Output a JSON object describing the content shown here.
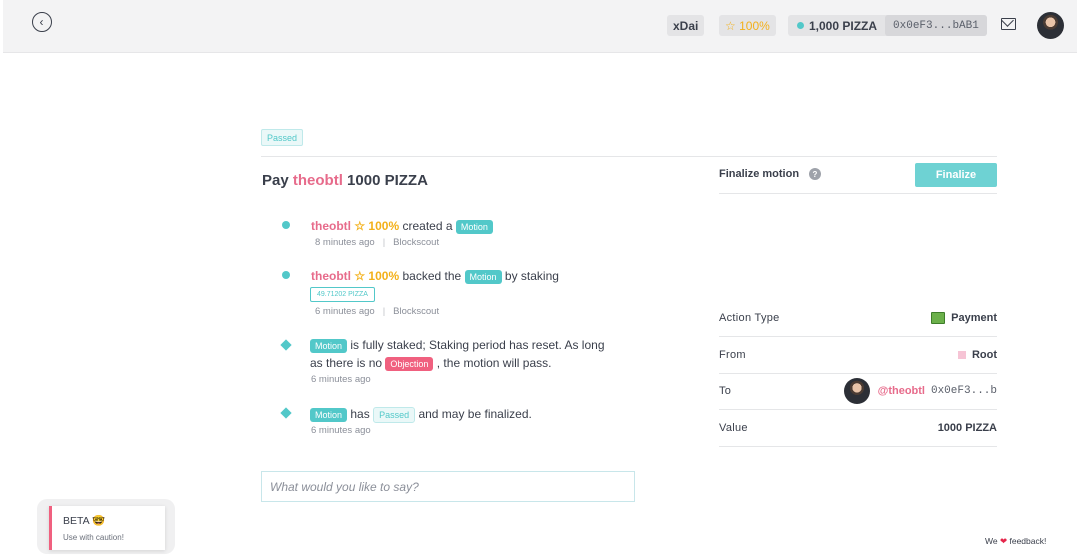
{
  "header": {
    "network": "xDai",
    "reputation": "☆ 100%",
    "balance": "1,000 PIZZA",
    "address": "0x0eF3...bAB1"
  },
  "motion": {
    "status": "Passed",
    "title_prefix": "Pay",
    "recipient": "theobtl",
    "title_suffix": "1000 PIZZA"
  },
  "events": [
    {
      "user": "theobtl",
      "rep": "☆ 100%",
      "text": "created a",
      "tag": "Motion",
      "time": "8 minutes ago",
      "source": "Blockscout"
    },
    {
      "user": "theobtl",
      "rep": "☆ 100%",
      "text": "backed the",
      "tag": "Motion",
      "text2": "by staking",
      "stake": "49.71202 PIZZA",
      "time": "6 minutes ago",
      "source": "Blockscout"
    },
    {
      "tag": "Motion",
      "text": "is fully staked; Staking period has reset. As long",
      "text_line2": "as there is no",
      "objection_tag": "Objection",
      "text_line2_end": ", the motion will pass.",
      "time": "6 minutes ago"
    },
    {
      "tag": "Motion",
      "text": "has",
      "status_tag": "Passed",
      "text2": "and may be finalized.",
      "time": "6 minutes ago"
    }
  ],
  "comment": {
    "placeholder": "What would you like to say?"
  },
  "finalize": {
    "label": "Finalize motion",
    "help": "?",
    "button": "Finalize"
  },
  "details": {
    "action_type_label": "Action Type",
    "action_type_value": "Payment",
    "from_label": "From",
    "from_value": "Root",
    "to_label": "To",
    "to_user": "@theobtl",
    "to_address": "0x0eF3...b",
    "value_label": "Value",
    "value_value": "1000 PIZZA"
  },
  "beta": {
    "title": "BETA 🤓",
    "subtitle": "Use with caution!"
  },
  "feedback": {
    "prefix": "We",
    "heart": "❤",
    "suffix": "feedback!"
  }
}
